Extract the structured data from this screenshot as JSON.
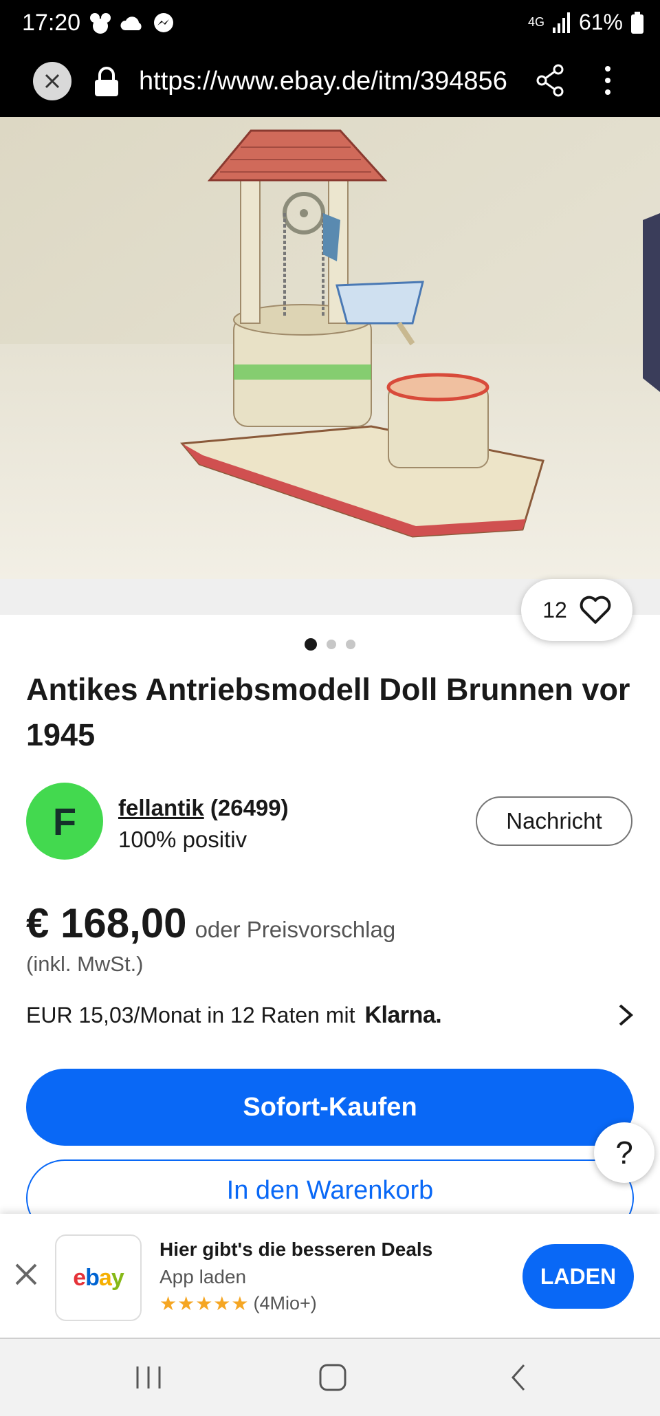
{
  "status_bar": {
    "time": "17:20",
    "network": "4G",
    "battery": "61%"
  },
  "browser": {
    "url": "https://www.ebay.de/itm/394856"
  },
  "gallery": {
    "watch_count": "12"
  },
  "listing": {
    "title": "Antikes Antriebsmodell Doll Brunnen vor 1945"
  },
  "seller": {
    "initial": "F",
    "name": "fellantik",
    "score": "(26499)",
    "feedback": "100% positiv",
    "message_label": "Nachricht"
  },
  "price": {
    "amount": "€ 168,00",
    "offer": "oder Preisvorschlag",
    "vat": "(inkl. MwSt.)"
  },
  "financing": {
    "text": "EUR 15,03/Monat in 12 Raten mit",
    "provider": "Klarna."
  },
  "buttons": {
    "buy_now": "Sofort-Kaufen",
    "add_to_cart": "In den Warenkorb",
    "help": "?"
  },
  "app_banner": {
    "title": "Hier gibt's die besseren Deals",
    "subtitle": "App laden",
    "rating_count": "(4Mio+)",
    "stars": "★★★★★",
    "load_label": "LADEN"
  },
  "colors": {
    "accent": "#0968f6",
    "avatar": "#43d94f",
    "star": "#f5a623"
  },
  "icons": [
    "close-icon",
    "lock-icon",
    "share-icon",
    "more-menu-icon",
    "heart-icon",
    "chevron-right-icon",
    "help-icon",
    "nav-recents-icon",
    "nav-home-icon",
    "nav-back-icon"
  ]
}
